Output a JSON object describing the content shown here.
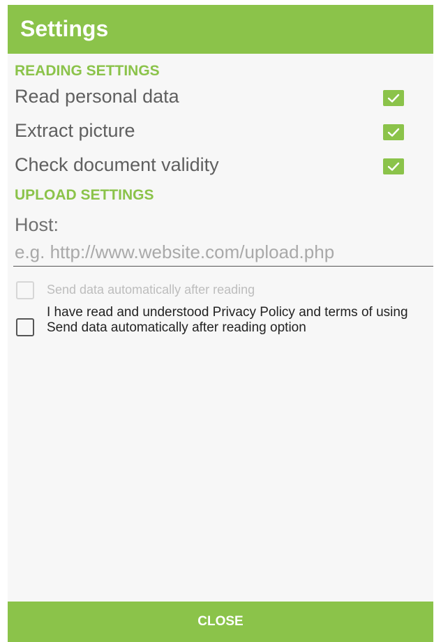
{
  "header": {
    "title": "Settings"
  },
  "reading_settings": {
    "section_title": "READING SETTINGS",
    "items": [
      {
        "label": "Read personal data",
        "checked": true
      },
      {
        "label": "Extract picture",
        "checked": true
      },
      {
        "label": "Check document validity",
        "checked": true
      }
    ]
  },
  "upload_settings": {
    "section_title": "UPLOAD SETTINGS",
    "host_label": "Host:",
    "host_value": "",
    "host_placeholder": "e.g. http://www.website.com/upload.php",
    "auto_send": {
      "label": "Send data automatically after reading",
      "checked": false,
      "enabled": false
    },
    "privacy": {
      "label": "I have read and understood Privacy Policy and terms of using Send data automatically after reading option",
      "checked": false
    }
  },
  "footer": {
    "close_label": "CLOSE"
  },
  "colors": {
    "accent": "#8bc34a",
    "background": "#f7f7f7",
    "text": "#5f5f5f"
  },
  "icons": {
    "checkbox_checked": "check-icon"
  }
}
